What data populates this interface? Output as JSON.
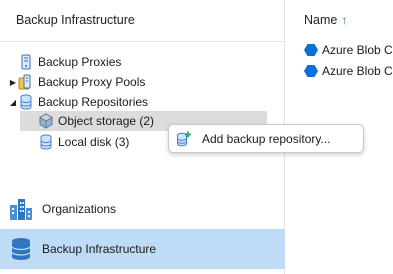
{
  "left_pane": {
    "title": "Backup Infrastructure",
    "tree": [
      {
        "label": "Backup Proxies",
        "icon": "server-icon",
        "expander": ""
      },
      {
        "label": "Backup Proxy Pools",
        "icon": "proxy-pool-icon",
        "expander": "▶"
      },
      {
        "label": "Backup Repositories",
        "icon": "repository-icon",
        "expander": "◢"
      },
      {
        "label": "Object storage (2)",
        "icon": "object-storage-icon",
        "expander": "",
        "selected": true
      },
      {
        "label": "Local disk (3)",
        "icon": "local-disk-icon",
        "expander": ""
      }
    ],
    "nav": [
      {
        "label": "Organizations",
        "icon": "organizations-icon",
        "active": false
      },
      {
        "label": "Backup Infrastructure",
        "icon": "database-icon",
        "active": true
      }
    ]
  },
  "right_pane": {
    "column_header": "Name",
    "sort_indicator": "↑",
    "rows": [
      {
        "label": "Azure Blob Co",
        "icon": "azure-hexagon-icon"
      },
      {
        "label": "Azure Blob Co",
        "icon": "azure-hexagon-icon"
      }
    ]
  },
  "context_menu": {
    "items": [
      {
        "label": "Add backup repository...",
        "icon": "add-repository-icon"
      }
    ]
  },
  "colors": {
    "accent": "#1d6fc2",
    "nav_active_bg": "#bfdcf7",
    "selected_row_bg": "#dcdcdc",
    "azure_blue": "#0a6fd6",
    "repo_blue": "#3b86d4"
  }
}
